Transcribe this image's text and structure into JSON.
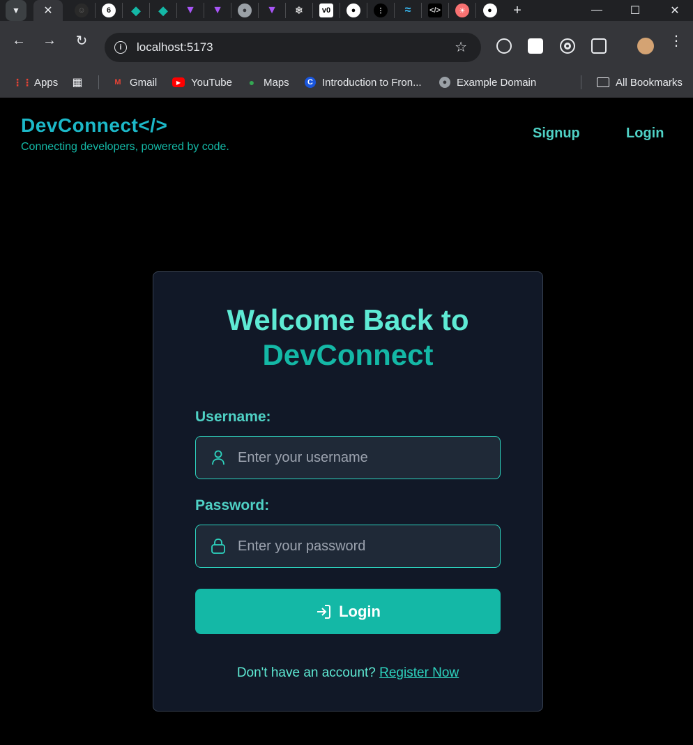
{
  "browser": {
    "url": "localhost:5173",
    "bookmarks": [
      {
        "label": "Apps",
        "icon": "apps-grid-icon"
      },
      {
        "label": "Gmail",
        "icon": "gmail-icon"
      },
      {
        "label": "YouTube",
        "icon": "youtube-icon"
      },
      {
        "label": "Maps",
        "icon": "maps-pin-icon"
      },
      {
        "label": "Introduction to Fron...",
        "icon": "c-icon"
      },
      {
        "label": "Example Domain",
        "icon": "globe-icon"
      }
    ],
    "all_bookmarks": "All Bookmarks"
  },
  "app": {
    "brand_name": "DevConnect</>",
    "tagline": "Connecting developers, powered by code.",
    "nav": {
      "signup": "Signup",
      "login": "Login"
    }
  },
  "login_form": {
    "title_line1": "Welcome Back to",
    "title_line2": "DevConnect",
    "username_label": "Username:",
    "username_placeholder": "Enter your username",
    "password_label": "Password:",
    "password_placeholder": "Enter your password",
    "submit_label": "Login",
    "footer_text": "Don't have an account? ",
    "register_link": "Register Now"
  },
  "colors": {
    "brand": "#1cb8c8",
    "accent": "#14b8a6",
    "card_bg": "#111827"
  }
}
